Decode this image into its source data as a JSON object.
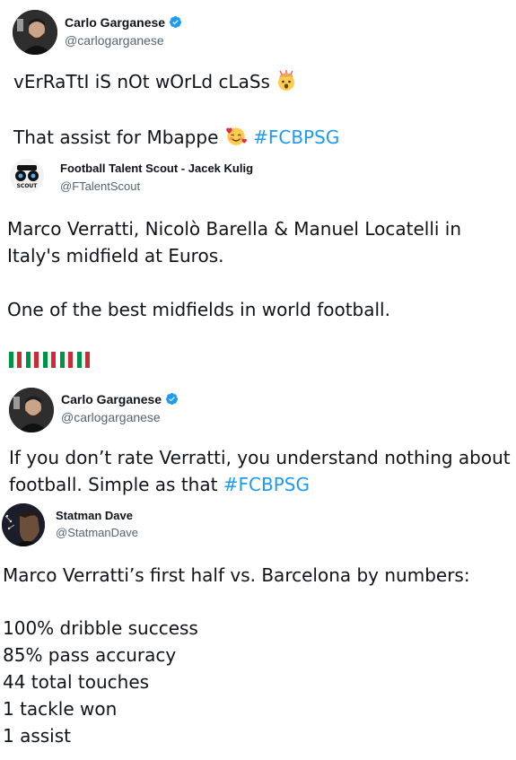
{
  "tweets": [
    {
      "name": "Carlo Garganese",
      "handle": "@carlogarganese",
      "verified": true,
      "line1": "vErRaTtI iS nOt wOrLd cLaSs",
      "line1_emoji": "exploding-head",
      "line2_text": "That assist for Mbappe",
      "line2_emoji": "smiling-face-with-hearts",
      "hashtag": "#FCBPSG"
    },
    {
      "name": "Football Talent Scout - Jacek Kulig",
      "handle": "@FTalentScout",
      "avatar_text": "SCOUT",
      "line1": "Marco Verratti, Nicolò Barella & Manuel Locatelli in",
      "line2": "Italy's midfield at Euros.",
      "line3": "One of the best midfields in world football.",
      "flags_label": "italy-flag"
    },
    {
      "name": "Carlo Garganese",
      "handle": "@carlogarganese",
      "verified": true,
      "line1": "If you don’t rate Verratti, you understand nothing about",
      "line2_text": "football. Simple as that",
      "hashtag": "#FCBPSG"
    },
    {
      "name": "Statman Dave",
      "handle": "@StatmanDave",
      "intro": "Marco Verratti’s first half vs. Barcelona by numbers:",
      "stats": [
        "100% dribble success",
        "85% pass accuracy",
        "44 total touches",
        "1 tackle won",
        "1 assist"
      ]
    }
  ],
  "colors": {
    "hashtag": "#1d9bf0",
    "verified": "#1d9bf0",
    "handle": "#536471"
  }
}
